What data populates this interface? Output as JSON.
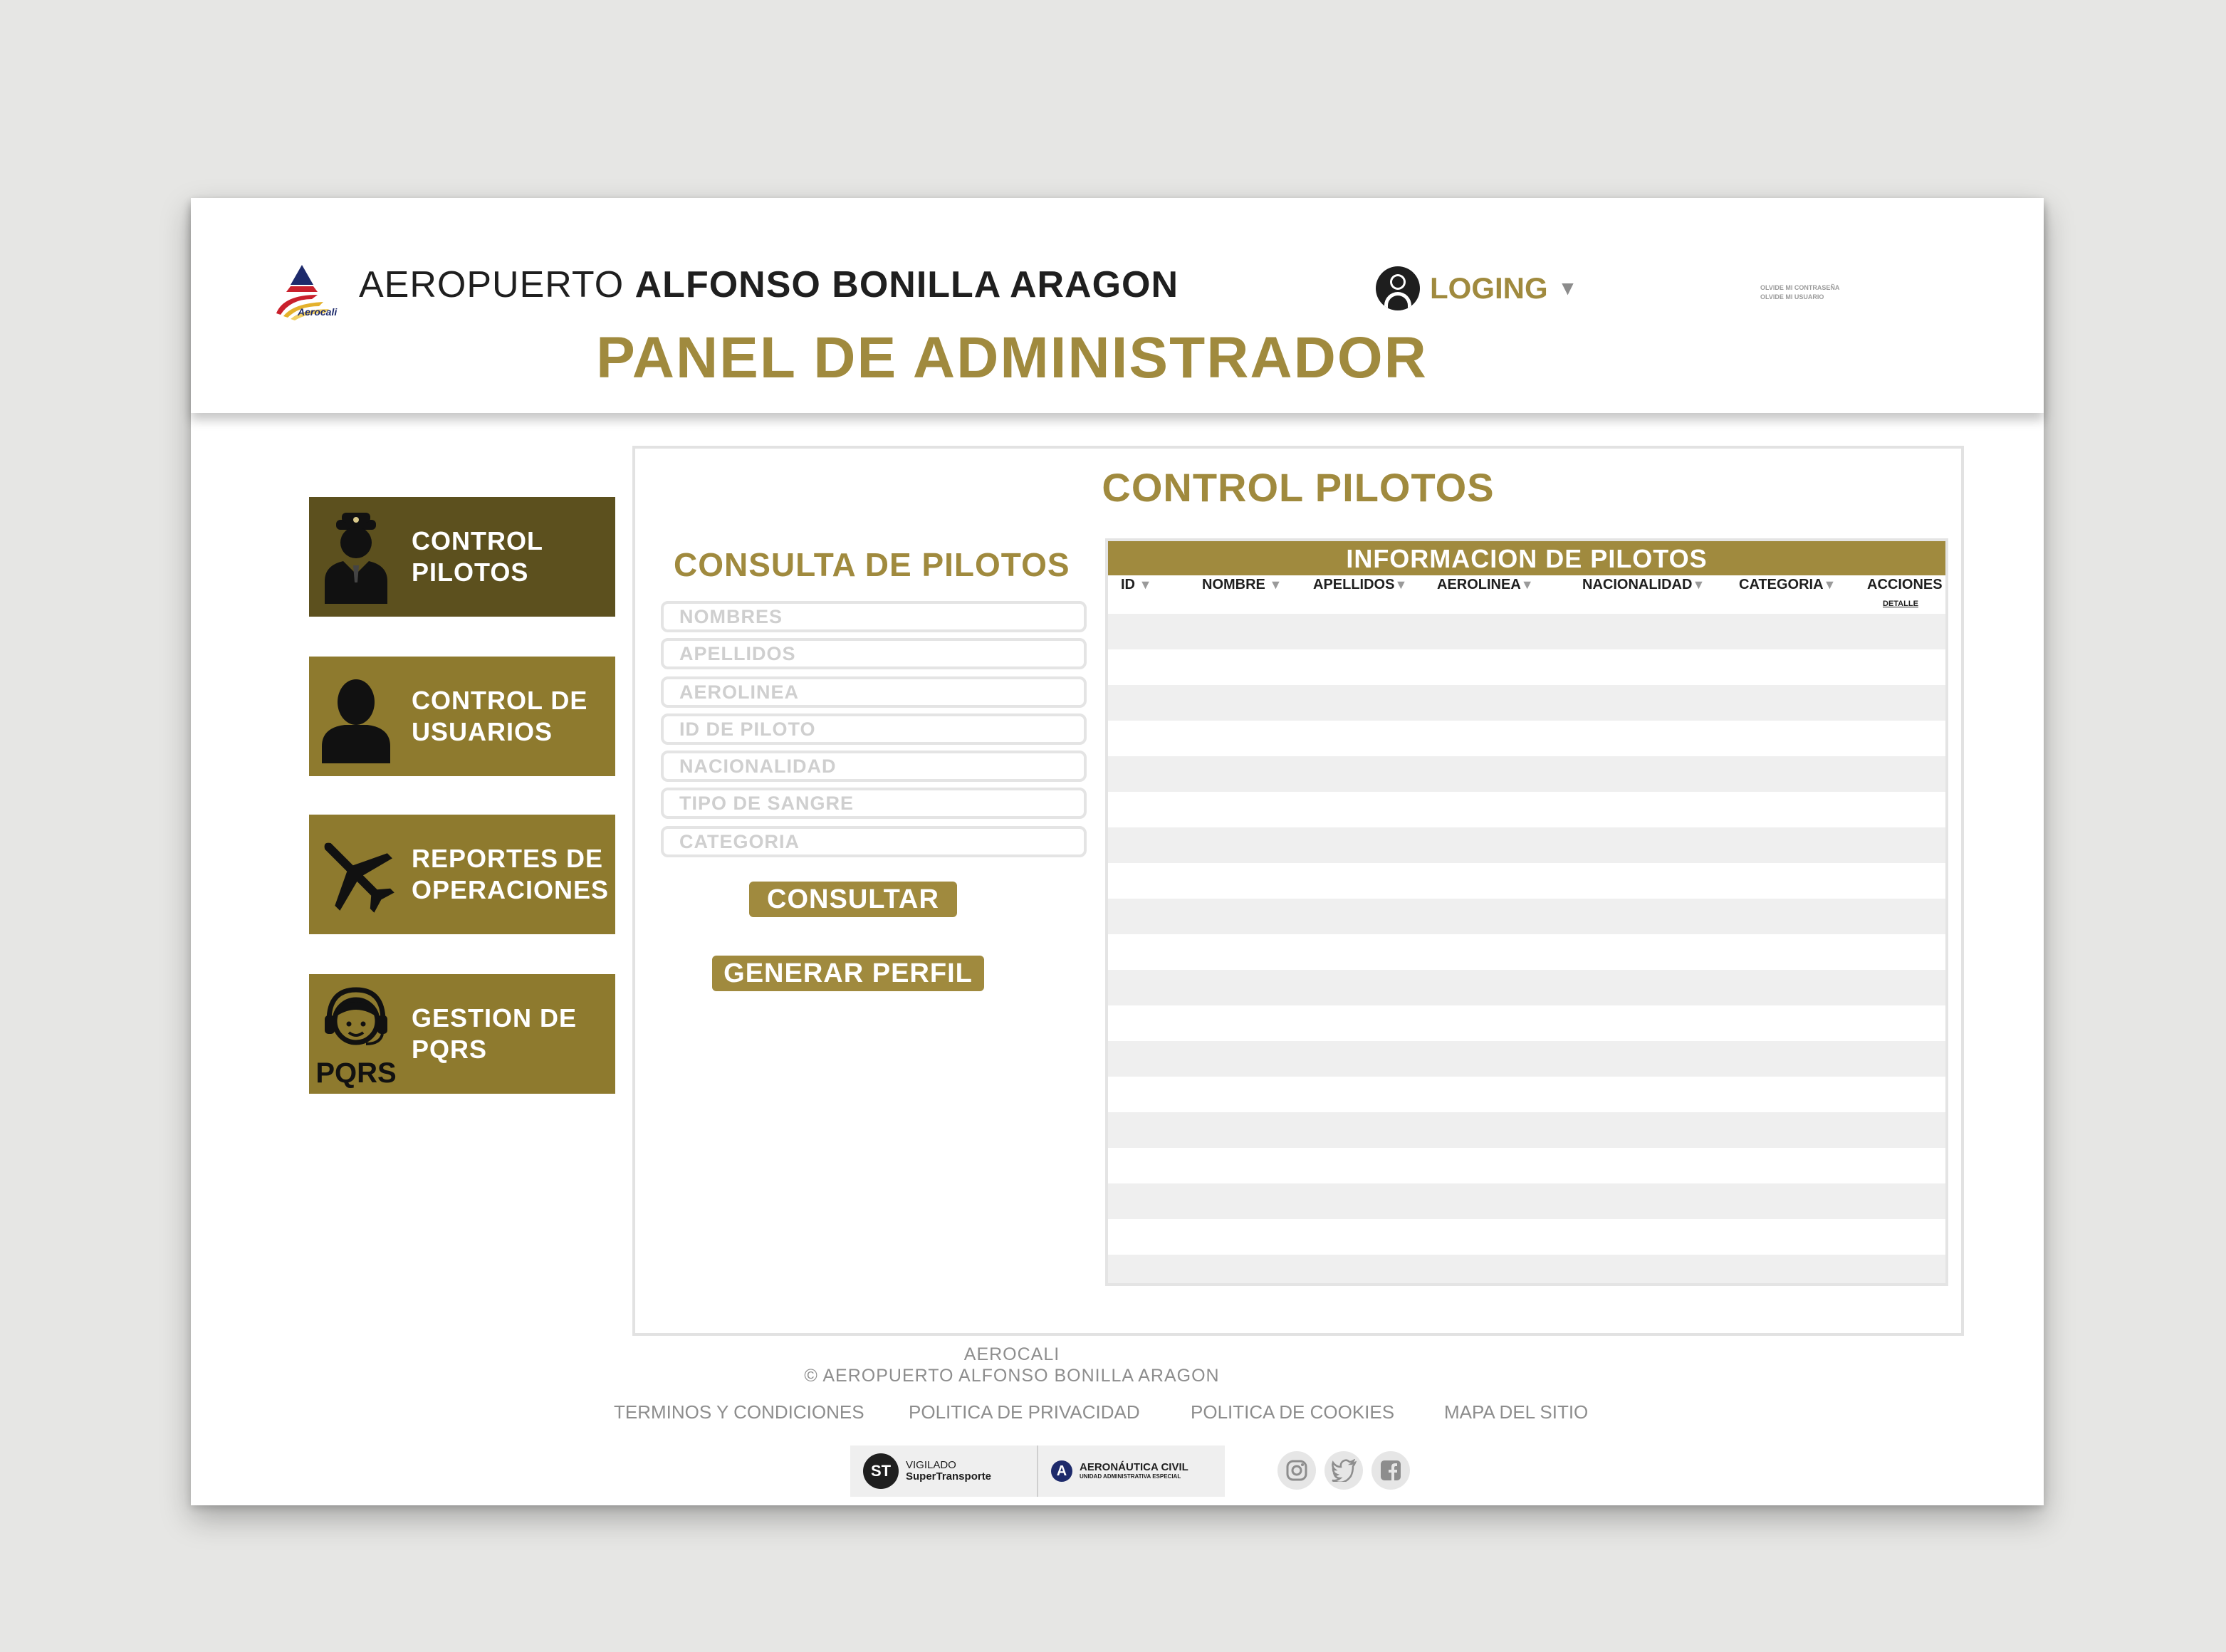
{
  "header": {
    "logo_text": "Aerocali",
    "title_light": "AEROPUERTO",
    "title_bold": "ALFONSO BONILLA ARAGON",
    "login_label": "LOGING",
    "forgot_password": "OLVIDE MI CONTRASEÑA",
    "forgot_user": "OLVIDE MI USUARIO",
    "panel_title": "PANEL DE ADMINISTRADOR"
  },
  "sidebar": {
    "items": [
      {
        "line1": "CONTROL",
        "line2": "PILOTOS",
        "icon": "pilot-icon"
      },
      {
        "line1": "CONTROL DE",
        "line2": "USUARIOS",
        "icon": "user-icon"
      },
      {
        "line1": "REPORTES DE",
        "line2": "OPERACIONES",
        "icon": "airplane-icon"
      },
      {
        "line1": "GESTION DE",
        "line2": "PQRS",
        "icon": "pqrs-headset-icon",
        "icon_text": "PQRS"
      }
    ]
  },
  "main": {
    "title": "CONTROL PILOTOS",
    "query_title": "CONSULTA DE PILOTOS",
    "fields": {
      "nombres": "NOMBRES",
      "apellidos": "APELLIDOS",
      "aerolinea": "AEROLINEA",
      "id_piloto": "ID DE PILOTO",
      "nacionalidad": "NACIONALIDAD",
      "tipo_sangre": "TIPO DE SANGRE",
      "categoria": "CATEGORIA"
    },
    "consultar_label": "CONSULTAR",
    "generar_label": "GENERAR PERFIL",
    "table": {
      "title": "INFORMACION DE PILOTOS",
      "columns": {
        "id": "ID",
        "nombre": "NOMBRE",
        "apellidos": "APELLIDOS",
        "aerolinea": "AEROLINEA",
        "nacionalidad": "NACIONALIDAD",
        "categoria": "CATEGORIA",
        "acciones": "ACCIONES"
      },
      "action_link": "DETALLE"
    }
  },
  "footer": {
    "brand": "AEROCALI",
    "copyright": "© AEROPUERTO ALFONSO BONILLA ARAGON",
    "links": {
      "terms": "TERMINOS Y CONDICIONES",
      "privacy": "POLITICA DE PRIVACIDAD",
      "cookies": "POLITICA DE COOKIES",
      "sitemap": "MAPA DEL SITIO"
    },
    "badge_st": {
      "logo": "ST",
      "line1": "VIGILADO",
      "line2": "SuperTransporte"
    },
    "badge_aero": {
      "logo": "A",
      "line1": "AERONÁUTICA CIVIL",
      "line2": "UNIDAD ADMINISTRATIVA ESPECIAL"
    },
    "social": [
      "instagram-icon",
      "twitter-icon",
      "facebook-icon"
    ]
  },
  "colors": {
    "gold": "#a08a3e",
    "gold_dark": "#5c501e",
    "gold_button": "#8e7a2e",
    "background": "#e6e6e4"
  }
}
